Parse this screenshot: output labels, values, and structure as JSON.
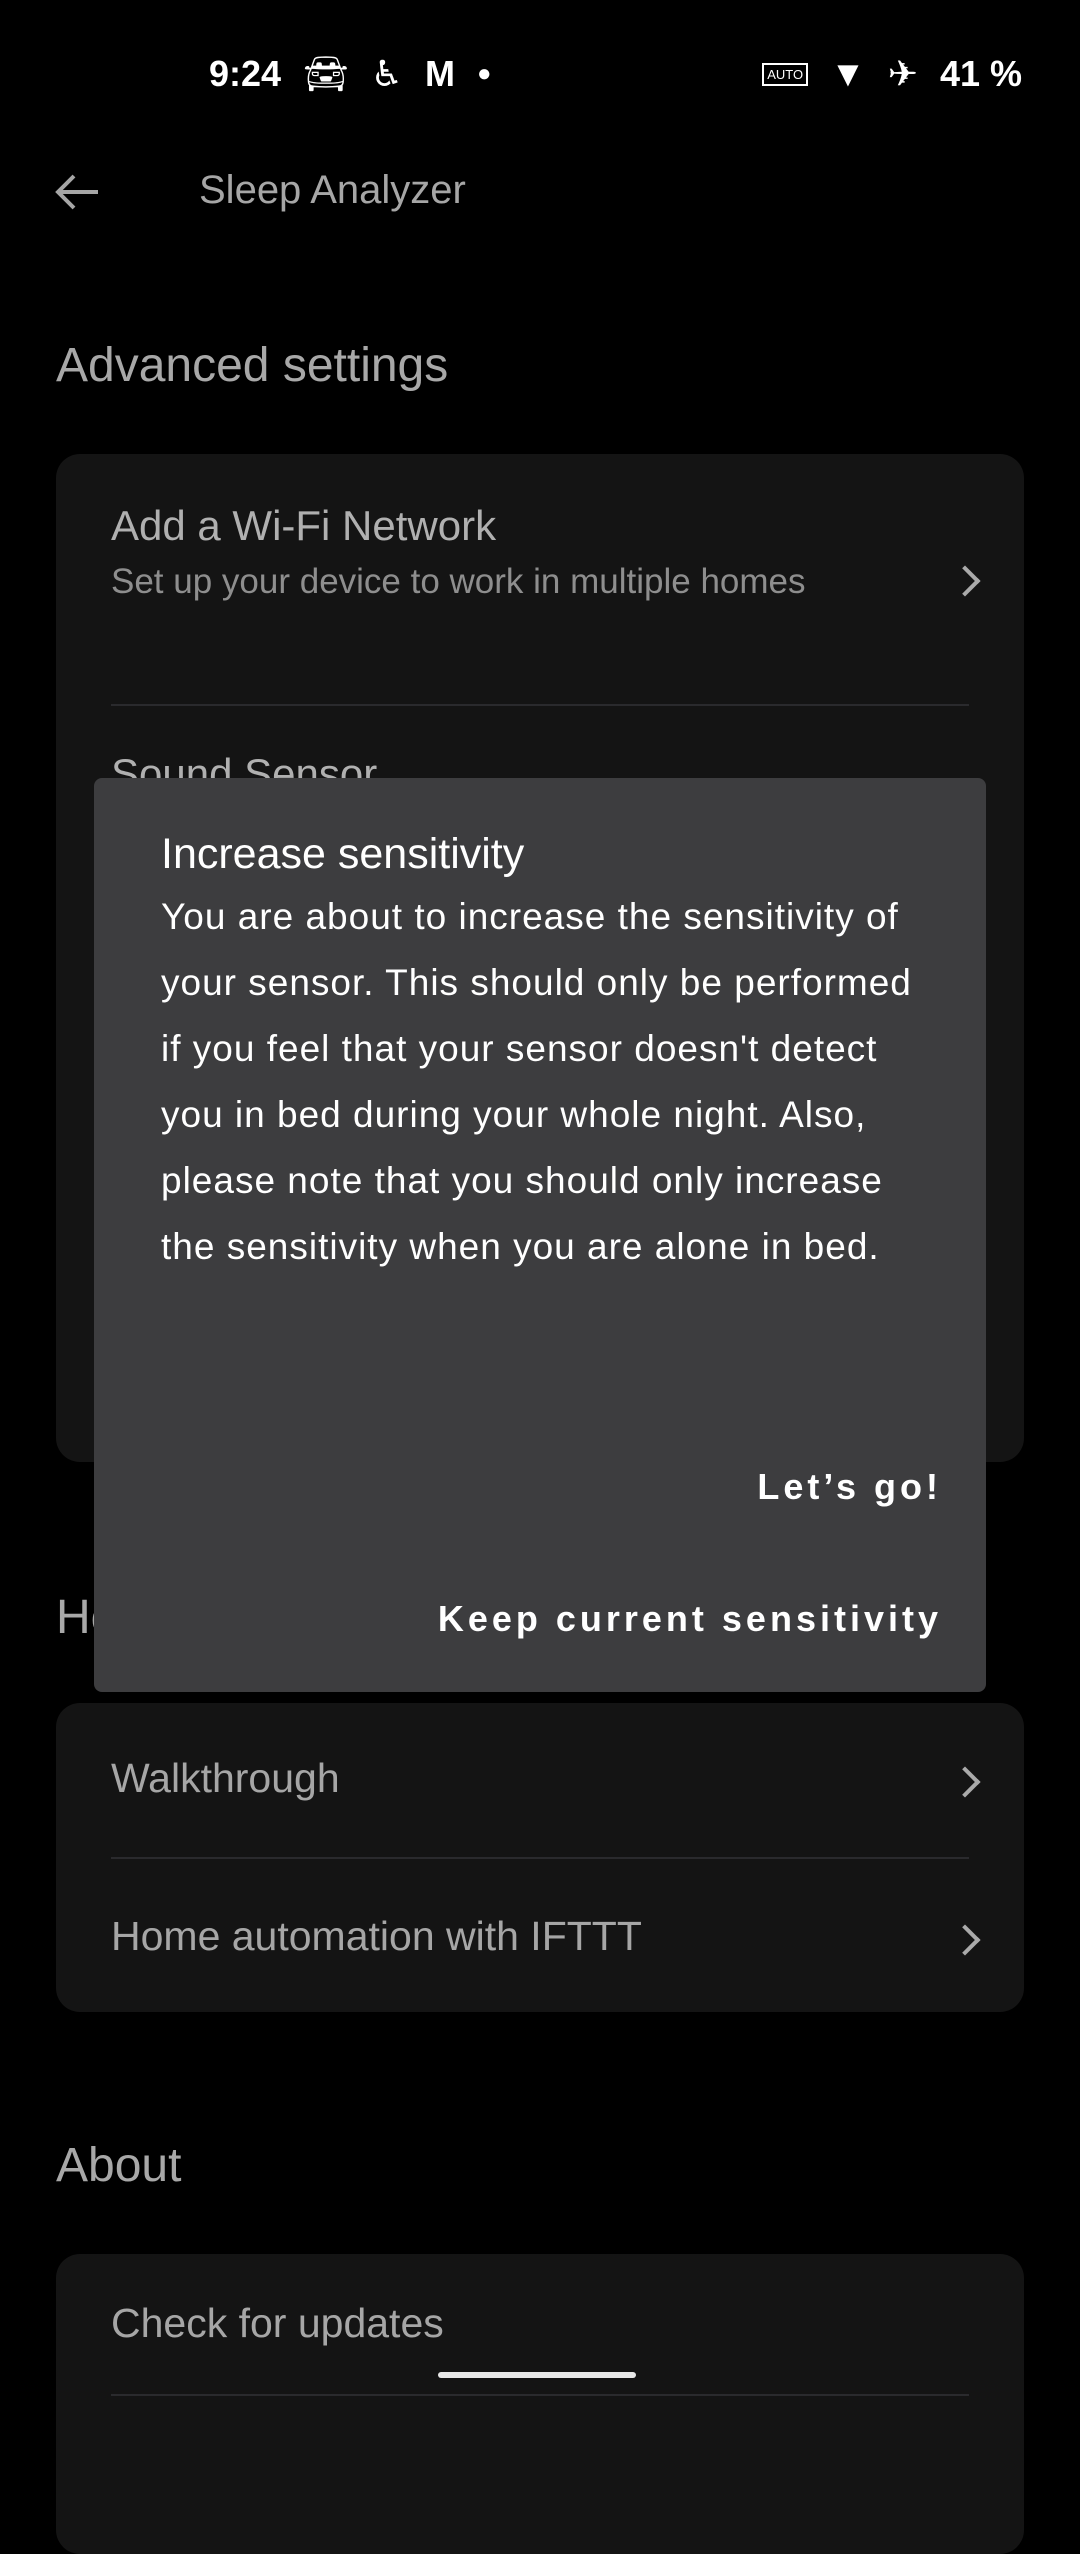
{
  "status_bar": {
    "time": "9:24",
    "battery": "41 %",
    "left_icons": [
      "car-icon",
      "accessibility-icon",
      "gmail-icon",
      "dot-icon"
    ],
    "right_icons": [
      "auto-hz-icon",
      "wifi-icon",
      "airplane-icon"
    ]
  },
  "header": {
    "title": "Sleep Analyzer",
    "back_icon": "arrow-left-icon"
  },
  "advanced": {
    "heading": "Advanced settings",
    "items": [
      {
        "title": "Add a Wi-Fi Network",
        "subtitle": "Set up your device to work in multiple homes"
      },
      {
        "title": "Sound Sensor"
      }
    ]
  },
  "help": {
    "heading": "Help",
    "items": [
      {
        "title": "Walkthrough"
      },
      {
        "title": "Home automation with IFTTT"
      }
    ]
  },
  "about": {
    "heading": "About",
    "items": [
      {
        "title": "Check for updates"
      }
    ]
  },
  "dialog": {
    "title": "Increase sensitivity",
    "body": "You are about to increase the sensitivity of your sensor. This should only be performed if you feel that your sensor doesn't detect you in bed during your whole night. Also, please note that you should only increase the sensitivity when you are alone in bed.",
    "confirm_label": "Let’s go!",
    "cancel_label": "Keep current sensitivity"
  },
  "colors": {
    "background": "#000000",
    "card": "#141414",
    "dialog": "#3d3d3f",
    "text": "#a6a6a6"
  }
}
